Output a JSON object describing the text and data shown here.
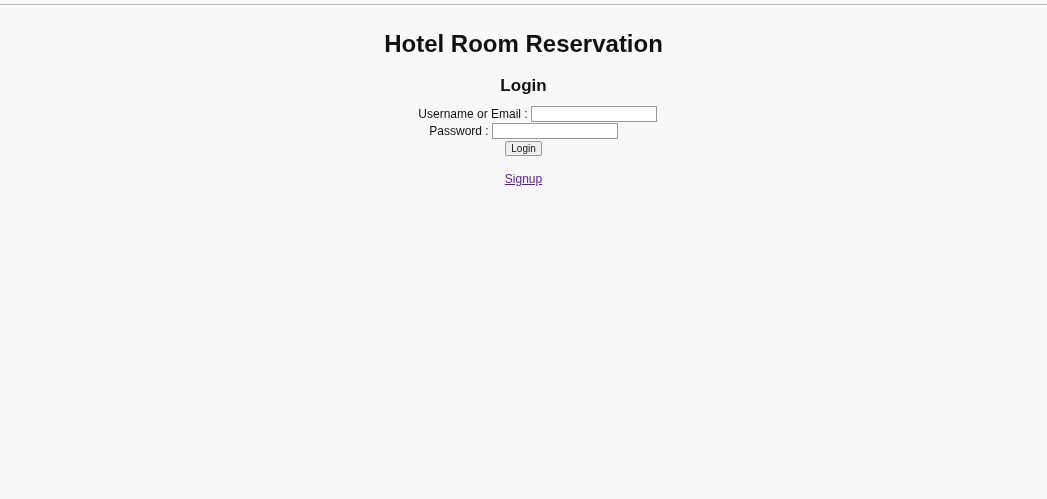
{
  "title": "Hotel Room Reservation",
  "login": {
    "heading": "Login",
    "fields": [
      {
        "label": "Username or Email :"
      },
      {
        "label": "Password :"
      }
    ],
    "button": "Login"
  },
  "signup_link": {
    "label": "Signup",
    "visited": true
  }
}
